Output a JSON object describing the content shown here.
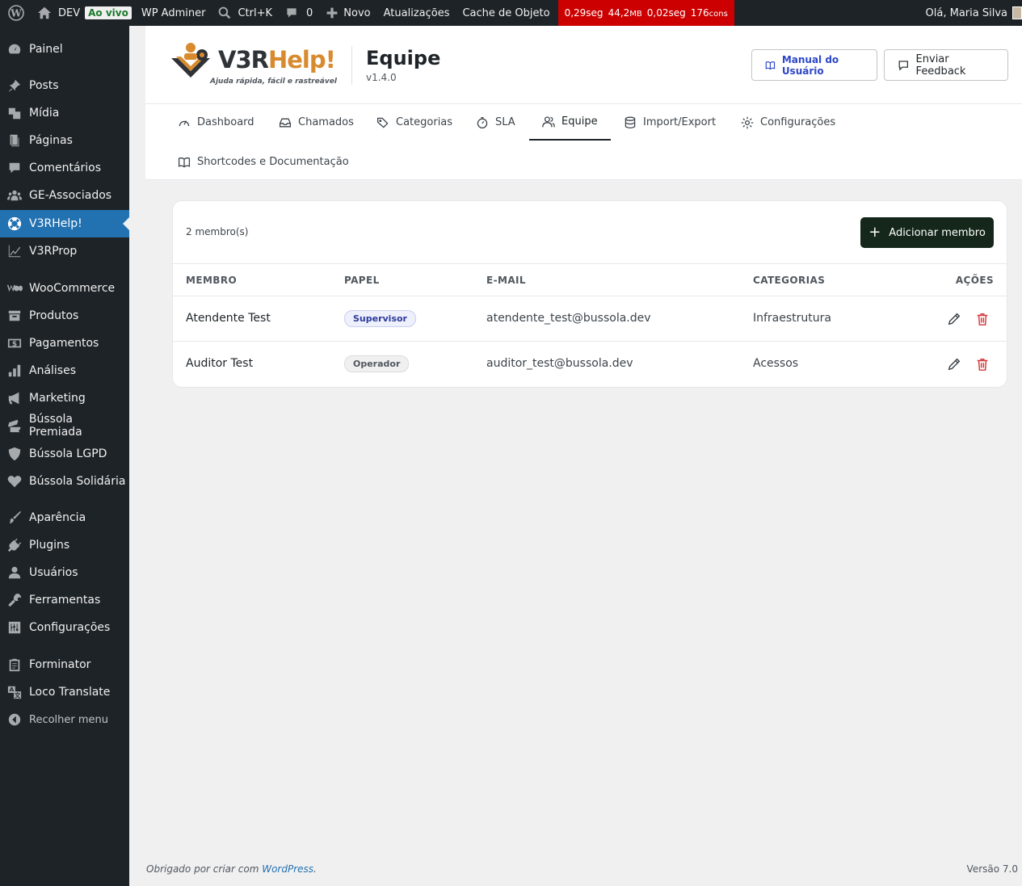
{
  "adminbar": {
    "site": "DEV",
    "live": "Ao vivo",
    "adminer": "WP Adminer",
    "search": "Ctrl+K",
    "comments": "0",
    "new": "Novo",
    "updates": "Atualizações",
    "cache": "Cache de Objeto",
    "perf": {
      "t1": "0,29seg",
      "mem": "44,2",
      "mem_unit": "MB",
      "t2": "0,02seg",
      "q": "176",
      "q_unit": "cons"
    },
    "greeting": "Olá, Maria Silva"
  },
  "sidebar": {
    "items": [
      {
        "label": "Painel",
        "icon": "dashboard-icon"
      },
      {
        "label": "Posts",
        "icon": "pin-icon"
      },
      {
        "label": "Mídia",
        "icon": "media-icon"
      },
      {
        "label": "Páginas",
        "icon": "pages-icon"
      },
      {
        "label": "Comentários",
        "icon": "comment-icon"
      },
      {
        "label": "GE-Associados",
        "icon": "groups-icon"
      },
      {
        "label": "V3RHelp!",
        "icon": "lifebuoy-icon"
      },
      {
        "label": "V3RProp",
        "icon": "chart-line-icon"
      },
      {
        "label": "WooCommerce",
        "icon": "woo-icon"
      },
      {
        "label": "Produtos",
        "icon": "archive-icon"
      },
      {
        "label": "Pagamentos",
        "icon": "money-icon"
      },
      {
        "label": "Análises",
        "icon": "bars-icon"
      },
      {
        "label": "Marketing",
        "icon": "megaphone-icon"
      },
      {
        "label": "Bússola Premiada",
        "icon": "tickets-icon"
      },
      {
        "label": "Bússola LGPD",
        "icon": "shield-icon"
      },
      {
        "label": "Bússola Solidária",
        "icon": "heart-icon"
      },
      {
        "label": "Aparência",
        "icon": "brush-icon"
      },
      {
        "label": "Plugins",
        "icon": "plugin-icon"
      },
      {
        "label": "Usuários",
        "icon": "user-icon"
      },
      {
        "label": "Ferramentas",
        "icon": "wrench-icon"
      },
      {
        "label": "Configurações",
        "icon": "settings-icon"
      },
      {
        "label": "Forminator",
        "icon": "clipboard-icon"
      },
      {
        "label": "Loco Translate",
        "icon": "translate-icon"
      }
    ],
    "collapse": "Recolher menu"
  },
  "header": {
    "brand": "V3RHelp!",
    "tagline": "Ajuda rápida, fácil e rastreável",
    "title": "Equipe",
    "version": "v1.4.0",
    "manual_label": "Manual do Usuário",
    "feedback_label": "Enviar Feedback"
  },
  "tabs": [
    {
      "label": "Dashboard"
    },
    {
      "label": "Chamados"
    },
    {
      "label": "Categorias"
    },
    {
      "label": "SLA"
    },
    {
      "label": "Equipe"
    },
    {
      "label": "Import/Export"
    },
    {
      "label": "Configurações"
    },
    {
      "label": "Shortcodes e Documentação"
    }
  ],
  "team": {
    "count": "2 membro(s)",
    "add_label": "Adicionar membro",
    "columns": {
      "member": "MEMBRO",
      "role": "PAPEL",
      "email": "E-MAIL",
      "categories": "CATEGORIAS",
      "actions": "AÇÕES"
    },
    "rows": [
      {
        "name": "Atendente Test",
        "role": "Supervisor",
        "email": "atendente_test@bussola.dev",
        "category": "Infraestrutura"
      },
      {
        "name": "Auditor Test",
        "role": "Operador",
        "email": "auditor_test@bussola.dev",
        "category": "Acessos"
      }
    ]
  },
  "footer": {
    "thanks_prefix": "Obrigado por criar com ",
    "thanks_link": "WordPress",
    "thanks_suffix": ".",
    "version": "Versão 7.0"
  },
  "colors": {
    "accent": "#2271b1",
    "dark_button": "#14271a",
    "danger": "#d63638",
    "sidebar": "#1d2327"
  }
}
